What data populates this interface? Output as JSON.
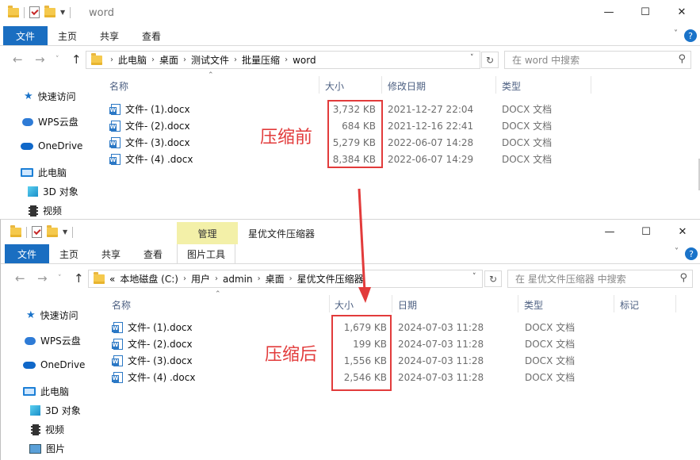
{
  "window_before": {
    "title": "word",
    "controls": {
      "minimize": "—",
      "maximize": "☐",
      "close": "✕"
    },
    "ribbon_tabs": [
      {
        "label": "文件"
      },
      {
        "label": "主页"
      },
      {
        "label": "共享"
      },
      {
        "label": "查看"
      }
    ],
    "breadcrumb": [
      "此电脑",
      "桌面",
      "测试文件",
      "批量压缩",
      "word"
    ],
    "search_placeholder": "在 word 中搜索",
    "sidebar": [
      "快速访问",
      "WPS云盘",
      "OneDrive",
      "此电脑",
      "3D 对象",
      "视频"
    ],
    "columns": [
      "名称",
      "大小",
      "修改日期",
      "类型"
    ],
    "files": [
      {
        "name": "文件- (1).docx",
        "size": "3,732 KB",
        "date": "2021-12-27 22:04",
        "type": "DOCX 文档"
      },
      {
        "name": "文件- (2).docx",
        "size": "684 KB",
        "date": "2021-12-16 22:41",
        "type": "DOCX 文档"
      },
      {
        "name": "文件- (3).docx",
        "size": "5,279 KB",
        "date": "2022-06-07 14:28",
        "type": "DOCX 文档"
      },
      {
        "name": "文件- (4) .docx",
        "size": "8,384 KB",
        "date": "2022-06-07 14:29",
        "type": "DOCX 文档"
      }
    ],
    "annotation": "压缩前"
  },
  "window_after": {
    "title": "星优文件压缩器",
    "context_tab": "管理",
    "controls": {
      "minimize": "—",
      "maximize": "☐",
      "close": "✕"
    },
    "ribbon_tabs": [
      {
        "label": "文件"
      },
      {
        "label": "主页"
      },
      {
        "label": "共享"
      },
      {
        "label": "查看"
      },
      {
        "label": "图片工具"
      }
    ],
    "breadcrumb_prefix": "«",
    "breadcrumb": [
      "本地磁盘 (C:)",
      "用户",
      "admin",
      "桌面",
      "星优文件压缩器"
    ],
    "search_placeholder": "在 星优文件压缩器 中搜索",
    "sidebar": [
      "快速访问",
      "WPS云盘",
      "OneDrive",
      "此电脑",
      "3D 对象",
      "视频",
      "图片"
    ],
    "columns": [
      "名称",
      "大小",
      "日期",
      "类型",
      "标记"
    ],
    "files": [
      {
        "name": "文件- (1).docx",
        "size": "1,679 KB",
        "date": "2024-07-03 11:28",
        "type": "DOCX 文档"
      },
      {
        "name": "文件- (2).docx",
        "size": "199 KB",
        "date": "2024-07-03 11:28",
        "type": "DOCX 文档"
      },
      {
        "name": "文件- (3).docx",
        "size": "1,556 KB",
        "date": "2024-07-03 11:28",
        "type": "DOCX 文档"
      },
      {
        "name": "文件- (4) .docx",
        "size": "2,546 KB",
        "date": "2024-07-03 11:28",
        "type": "DOCX 文档"
      }
    ],
    "annotation": "压缩后"
  },
  "colors": {
    "accent": "#1a6ec1",
    "highlight": "#e23b3b",
    "context_tab": "#f3f0a8"
  }
}
